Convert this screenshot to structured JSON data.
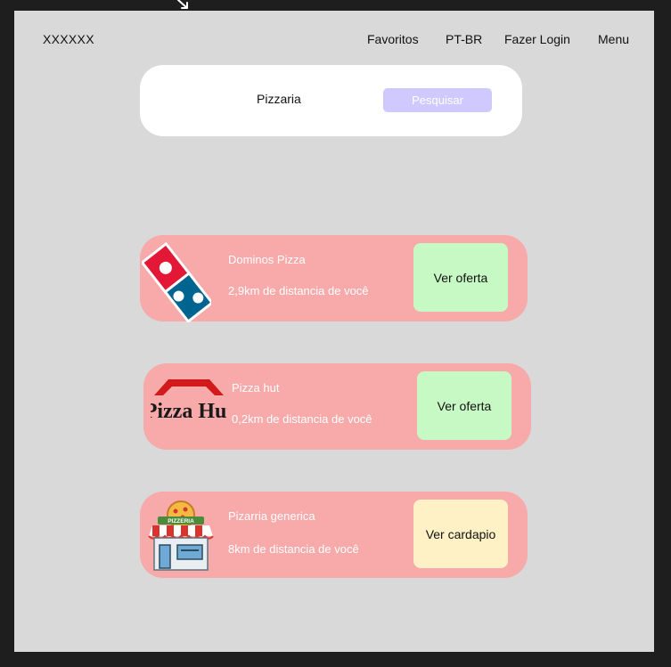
{
  "header": {
    "logo": "XXXXXX",
    "nav": {
      "favorites": "Favoritos",
      "language": "PT-BR",
      "login": "Fazer Login",
      "menu": "Menu"
    }
  },
  "search": {
    "value": "Pizzaria",
    "button_label": "Pesquisar"
  },
  "results": [
    {
      "name": "Dominos Pizza",
      "distance": "2,9km de distancia de você",
      "action": "Ver oferta",
      "logo_icon": "dominos-logo-icon"
    },
    {
      "name": "Pizza hut",
      "distance": "0,2km de distancia de você",
      "action": "Ver oferta",
      "logo_icon": "pizza-hut-logo-icon",
      "logo_text": "Pizza Hut"
    },
    {
      "name": "Pizarria generica",
      "distance": "8km de distancia de você",
      "action": "Ver cardapio",
      "logo_icon": "pizzeria-storefront-icon",
      "logo_text": "PIZZERIA"
    }
  ],
  "colors": {
    "canvas": "#1e1e1e",
    "frame": "#d9d9d9",
    "search_box": "#ffffff",
    "search_button": "#cfc9ff",
    "card": "#f8a9a9",
    "offer_button": "#c7f9c4",
    "menu_button": "#fff1c6",
    "dominos_red": "#e31837",
    "dominos_blue": "#006491",
    "pizza_hut_red": "#d31a1a"
  }
}
